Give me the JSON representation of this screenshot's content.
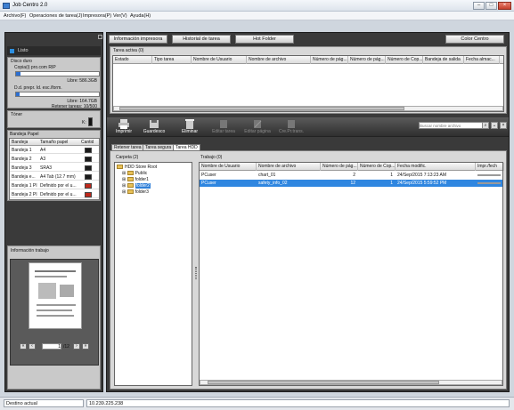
{
  "window": {
    "title": "Job Centro 2.0"
  },
  "menu": [
    "Archivo(F)",
    "Operaciones de tarea(J)",
    "Impresora(P)",
    "Ver(V)",
    "Ayuda(H)"
  ],
  "left": {
    "status": "Listo",
    "disk": {
      "section": "Disco duro",
      "rip_label": "Copia(i) pro.com RIP",
      "rip_free": "Libre: 586.3GB",
      "rip_fill": 0.05,
      "job_label": "D.d. prepr. Id. esc./form.",
      "job_free": "Libre: 164.7GB",
      "job_fill": 0.04,
      "retain": "Retener tareas: 10/500"
    },
    "toner_label": "Tóner",
    "toner_k": "K:",
    "tray_section": "Bandeja Papel",
    "tray_headers": [
      "Bandeja",
      "Tamaño papel",
      "Cantid"
    ],
    "trays": [
      {
        "name": "Bandeja 1",
        "size": "A4",
        "color": "#1a1a1a"
      },
      {
        "name": "Bandeja 2",
        "size": "A3",
        "color": "#1a1a1a"
      },
      {
        "name": "Bandeja 3",
        "size": "SRA3",
        "color": "#1a1a1a"
      },
      {
        "name": "Bandeja e...",
        "size": "A4 Tab (12.7 mm)",
        "color": "#1a1a1a"
      },
      {
        "name": "Bandeja 1 PI",
        "size": "Definido por el u...",
        "color": "#c0281b"
      },
      {
        "name": "Bandeja 2 PI",
        "size": "Definido por el u...",
        "color": "#c0281b"
      }
    ],
    "info_section": "Información trabajo",
    "page_input": "1",
    "page_total": "/12"
  },
  "top_buttons": {
    "printer_info": "Información impresora",
    "job_history": "Historial de tarea",
    "hot_folder": "Hot Folder",
    "color_centro": "Color Centro"
  },
  "active_job": {
    "title": "Tarea activa (0)",
    "headers": [
      "Estado",
      "Tipo tarea",
      "Nombre de Usuario",
      "Nombre de archivo",
      "Número de pág...",
      "Número de pág...",
      "Número de Cop...",
      "Bandeja de salida",
      "Fecha almac..."
    ]
  },
  "toolbar": {
    "print": "Imprimir",
    "save": "Guardesco",
    "delete": "Eliminar",
    "edit_job": "Editar tarea",
    "edit_page": "Editar página",
    "crear": "Cre.Pr.trans.",
    "search_placeholder": "Buscar nombre archivo"
  },
  "tabs": [
    "Retener tarea",
    "Tarea segura",
    "Tarea HDD"
  ],
  "folders": {
    "title": "Carpeta (2)",
    "root": "HDD Store Root",
    "items": [
      "Public",
      "folder1",
      "folder2",
      "folder3"
    ]
  },
  "jobs": {
    "title": "Trabajo (0)",
    "headers": [
      "Nombre de Usuario",
      "Nombre de archivo",
      "Número de pág...",
      "Número de Cop...",
      "Fecha modific.",
      "Impr./fech"
    ],
    "rows": [
      {
        "user": "PCuser",
        "file": "chart_01",
        "pages": "2",
        "copies": "1",
        "date": "24/Sep/2015 7:13:23 AM"
      },
      {
        "user": "PCuser",
        "file": "safety_info_02",
        "pages": "12",
        "copies": "1",
        "date": "24/Sep/2015 5:59:52 PM"
      }
    ]
  },
  "statusbar": {
    "label": "Destino actual",
    "ip": "10.239.225.238"
  }
}
